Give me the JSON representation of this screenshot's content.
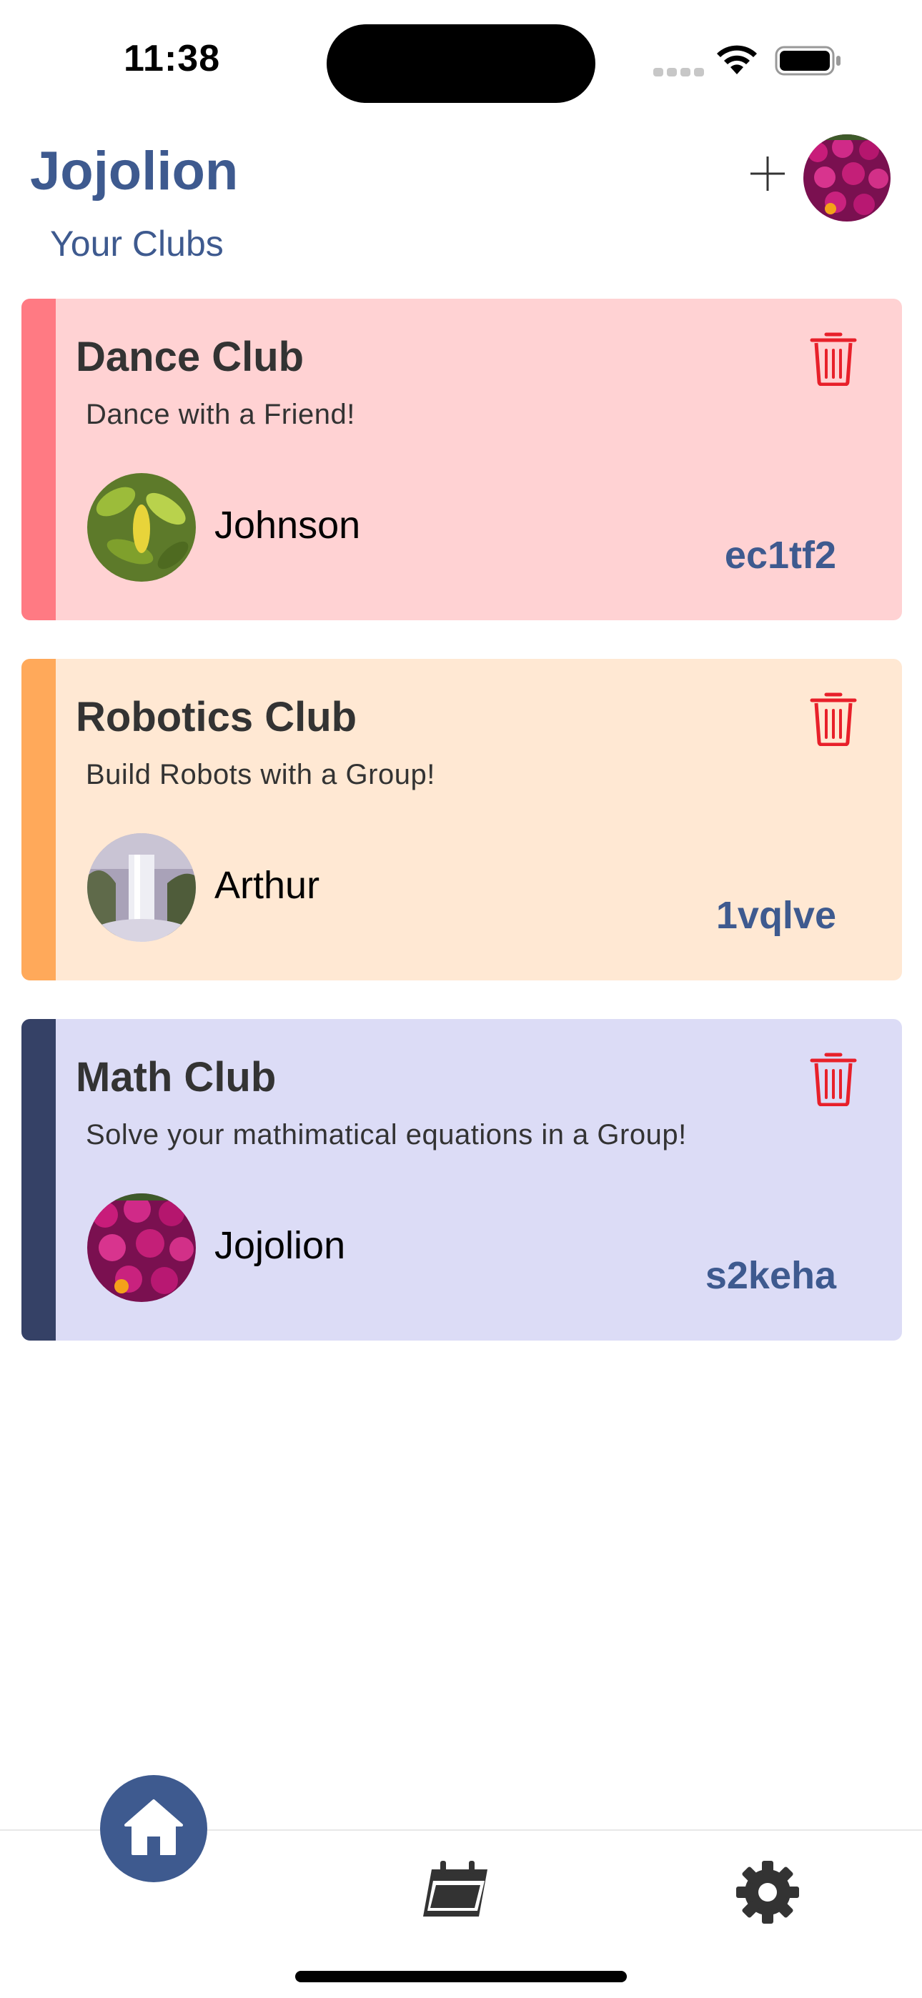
{
  "status_bar": {
    "time": "11:38"
  },
  "header": {
    "title": "Jojolion",
    "subtitle": "Your Clubs"
  },
  "clubs": [
    {
      "name": "Dance Club",
      "description": "Dance with a Friend!",
      "owner": "Johnson",
      "code": "ec1tf2",
      "background": "#ffd2d3",
      "accent": "#ff7a83"
    },
    {
      "name": "Robotics Club",
      "description": "Build Robots with a Group!",
      "owner": "Arthur",
      "code": "1vqlve",
      "background": "#ffe8d3",
      "accent": "#ffa95a"
    },
    {
      "name": "Math Club",
      "description": "Solve your mathimatical equations in a Group!",
      "owner": "Jojolion",
      "code": "s2keha",
      "background": "#dcdcf6",
      "accent": "#354166"
    }
  ],
  "icons": {
    "add": "plus-icon",
    "delete": "trash-icon",
    "home": "home-icon",
    "calendar": "calendar-icon",
    "settings": "gear-icon"
  },
  "colors": {
    "primary": "#3e5a8f",
    "delete": "#e8202a"
  }
}
